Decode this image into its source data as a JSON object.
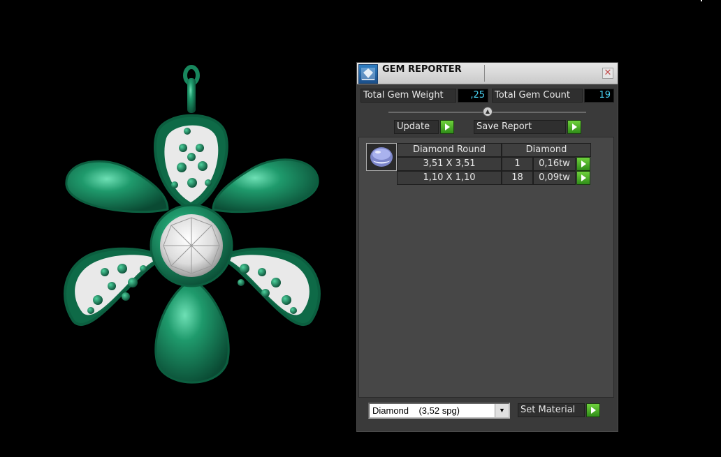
{
  "panel": {
    "title": "GEM REPORTER",
    "close_glyph": "✕",
    "total_gem_weight_label": "Total Gem Weight",
    "total_gem_weight_value": ",25",
    "total_gem_count_label": "Total Gem Count",
    "total_gem_count_value": "19",
    "update_label": "Update",
    "save_report_label": "Save Report",
    "slider_glyph": "▲",
    "report": {
      "shape_header": "Diamond Round",
      "material_header": "Diamond",
      "rows": [
        {
          "size": "3,51 X 3,51",
          "count": "1",
          "weight": "0,16tw"
        },
        {
          "size": "1,10 X 1,10",
          "count": "18",
          "weight": "0,09tw"
        }
      ]
    },
    "material_select_value": "Diamond    (3,52 spg)",
    "select_arrow": "▼",
    "set_material_label": "Set Material"
  },
  "colors": {
    "value_text": "#4ad5f5",
    "go_button": "#4fb52a",
    "metal": "#1e7f5a"
  },
  "icons": [
    "gem-reporter-icon",
    "close-icon",
    "play-arrow-icon",
    "gem-thumbnail-icon",
    "dropdown-arrow-icon"
  ]
}
